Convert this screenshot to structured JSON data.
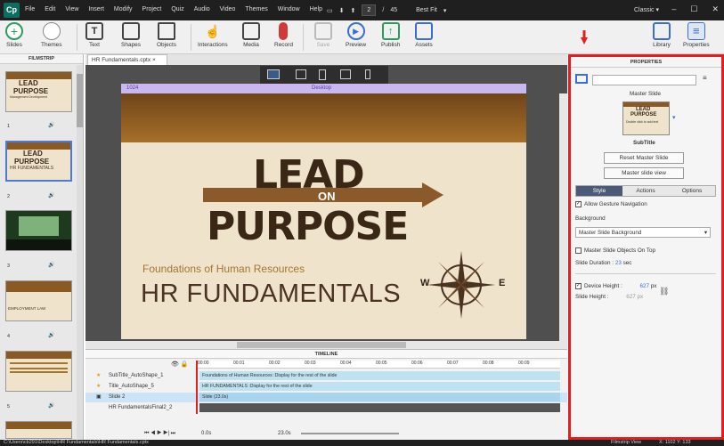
{
  "app": {
    "logo": "Cp",
    "menus": [
      "File",
      "Edit",
      "View",
      "Insert",
      "Modify",
      "Project",
      "Quiz",
      "Audio",
      "Video",
      "Themes",
      "Window",
      "Help"
    ],
    "page_current": "2",
    "page_total": "45",
    "zoom": "Best Fit",
    "mode": "Classic"
  },
  "toolbar": {
    "items": [
      "Slides",
      "Themes",
      "Text",
      "Shapes",
      "Objects",
      "Interactions",
      "Media",
      "Record",
      "Save",
      "Preview",
      "Publish",
      "Assets",
      "Library",
      "Properties"
    ]
  },
  "filmstrip": {
    "title": "FILMSTRIP",
    "slides": [
      {
        "num": "1",
        "lead": "LEAD",
        "purpose": "PURPOSE",
        "text": "Management Development"
      },
      {
        "num": "2",
        "lead": "LEAD",
        "purpose": "PURPOSE",
        "text": "HR FUNDAMENTALS"
      },
      {
        "num": "3",
        "text": ""
      },
      {
        "num": "4",
        "text": "EMPLOYMENT LAW"
      },
      {
        "num": "5",
        "text": ""
      }
    ]
  },
  "doc": {
    "tab": "HR Fundamentals.cptx",
    "ruler_width": "1024",
    "ruler_label": "Desktop"
  },
  "slide": {
    "lead": "LEAD",
    "on": "ON",
    "purpose": "PURPOSE",
    "subtitle": "Foundations of Human Resources",
    "title": "HR FUNDAMENTALS",
    "compass_w": "W",
    "compass_e": "E"
  },
  "timeline": {
    "title": "TIMELINE",
    "rows": [
      {
        "name": "SubTitle_AutoShape_1",
        "bar": "Foundations of Human Resources :Display for the rest of the slide"
      },
      {
        "name": "Title_AutoShape_5",
        "bar": "HR FUNDAMENTALS :Display for the rest of the slide"
      },
      {
        "name": "Slide 2",
        "bar": "Slide (23.0s)"
      },
      {
        "name": "HR FundamentalsFinal2_2",
        "bar": ""
      }
    ],
    "ticks": [
      "00:00",
      "00:01",
      "00:02",
      "00:03",
      "00:04",
      "00:05",
      "00:06",
      "00:07",
      "00:08",
      "00:09"
    ],
    "time_start": "0.0s",
    "time_end": "23.0s"
  },
  "properties": {
    "title": "PROPERTIES",
    "master_slide_label": "Master Slide",
    "thumb_lead": "LEAD",
    "thumb_purpose": "PURPOSE",
    "thumb_caption": "Double click to add text",
    "master_name": "SubTitle",
    "reset_btn": "Reset Master Slide",
    "view_btn": "Master slide view",
    "tabs": [
      "Style",
      "Actions",
      "Options"
    ],
    "gesture": "Allow Gesture Navigation",
    "background_label": "Background",
    "background_value": "Master Slide Background",
    "objects_on_top": "Master Slide Objects On Top",
    "duration_label": "Slide Duration :",
    "duration_value": "23",
    "duration_unit": "sec",
    "device_height_label": "Device Height :",
    "device_height_value": "627",
    "height_unit": "px",
    "slide_height_label": "Slide Height :",
    "slide_height_value": "627"
  },
  "status": {
    "path": "C:\\Users\\cb291\\Desktop\\HR Fundamentals\\HR Fundamentals.cptx",
    "view": "Filmstrip View",
    "coords": "X: 1102 Y: 133"
  },
  "colors": {
    "accent": "#4a5a78",
    "highlight": "#e02020",
    "timeline_bar": "#bfe2f2",
    "ruler": "#c9b8ef"
  }
}
